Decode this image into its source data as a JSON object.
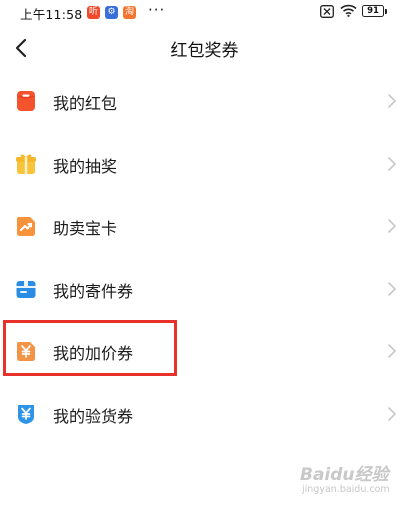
{
  "status_bar": {
    "time": "上午11:58",
    "app_icons": [
      {
        "name": "listen-app-icon",
        "glyph": "听",
        "color": "#f04a2b"
      },
      {
        "name": "settings-app-icon",
        "glyph": "⚙",
        "color": "#3a6fd8"
      },
      {
        "name": "xianyu-app-icon",
        "glyph": "淘",
        "color": "#f5742e"
      }
    ],
    "more_dots": "···",
    "battery": "91"
  },
  "nav": {
    "title": "红包奖券"
  },
  "menu": {
    "items": [
      {
        "label": "我的红包",
        "icon": "red-envelope-icon",
        "color": "#f5532d"
      },
      {
        "label": "我的抽奖",
        "icon": "gift-box-icon",
        "color": "#f8c53a"
      },
      {
        "label": "助卖宝卡",
        "icon": "trend-card-icon",
        "color": "#f7933a"
      },
      {
        "label": "我的寄件券",
        "icon": "delivery-box-icon",
        "color": "#2a8de3"
      },
      {
        "label": "我的加价券",
        "icon": "yuan-coupon-icon",
        "color": "#f39345"
      },
      {
        "label": "我的验货券",
        "icon": "yuan-shield-icon",
        "color": "#2d94e8"
      }
    ]
  },
  "highlight_color": "#e8312b",
  "watermark": {
    "text": "Baidu经验",
    "subtext": "jingyan.baidu.com"
  }
}
